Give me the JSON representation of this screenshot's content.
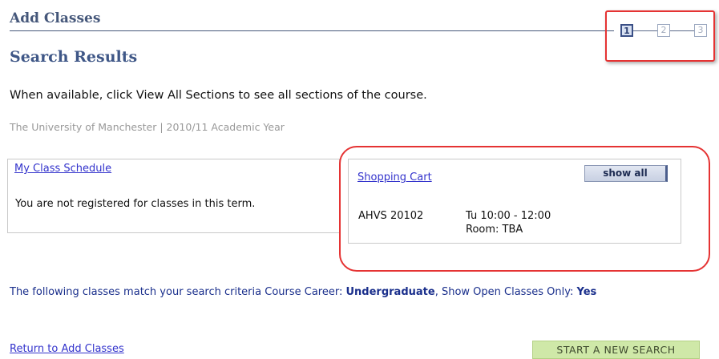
{
  "header": {
    "title": "Add Classes",
    "subtitle": "Search Results"
  },
  "steps": [
    "1",
    "2",
    "3"
  ],
  "instruction": "When available, click View All Sections to see all sections of the course.",
  "institution": "The University of Manchester | 2010/11 Academic Year",
  "schedule": {
    "link_label": "My Class Schedule",
    "message": "You are not registered for classes in this term."
  },
  "cart": {
    "link_label": "Shopping Cart",
    "show_all_label": "show all",
    "course_code": "AHVS 20102",
    "time": "Tu 10:00 - 12:00",
    "room": "Room:  TBA"
  },
  "criteria": {
    "prefix": "The following classes match your search criteria Course Career: ",
    "career": "Undergraduate",
    "middle": ",  Show Open Classes Only: ",
    "open_only": "Yes"
  },
  "footer": {
    "return_label": "Return to Add Classes",
    "new_search_label": "START A NEW SEARCH"
  },
  "colors": {
    "heading": "#45577a",
    "highlight": "#e53333",
    "link": "#3333cc",
    "new_search_button": "#cfe8a8"
  }
}
